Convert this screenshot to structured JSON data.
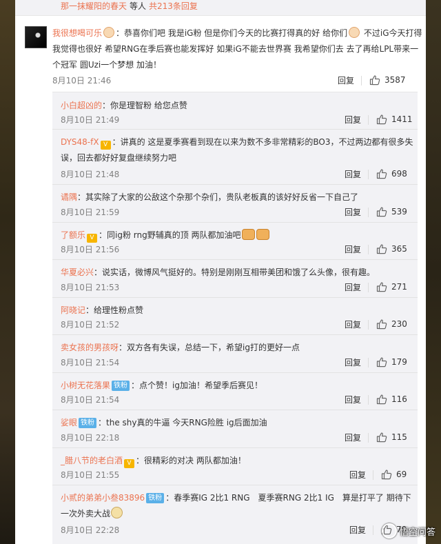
{
  "more_bar": {
    "user": "那一抹耀阳的春天",
    "mid": "等人",
    "count_text": "共213条回复"
  },
  "main_comment": {
    "user": "我很想喝可乐",
    "text_a": "：恭喜你们吧 我是iG粉 但是你们今天的比赛打得真的好 给你们",
    "text_b": " 不过iG今天打得我觉得也很好 希望RNG在季后赛也能发挥好 如果iG不能去世界赛 我希望你们去 去了再给LPL带来一个冠军 圆Uzi一个梦想 加油！",
    "date": "8月10日 21:46",
    "reply_label": "回复",
    "likes": "3587"
  },
  "replies": [
    {
      "user": "小白超凶的",
      "text": "：你是理智粉 给您点赞",
      "date": "8月10日 21:49",
      "reply_label": "回复",
      "likes": "1411"
    },
    {
      "user": "DYS48-fX",
      "text": "：讲真的 这是夏季赛看到现在以来为数不多非常精彩的BO3，不过两边都有很多失误，回去都好好复盘继续努力吧",
      "date": "8月10日 21:48",
      "reply_label": "回复",
      "likes": "698"
    },
    {
      "user": "谲隅",
      "text": "：其实除了大家的公敌这个杂那个杂们，贵队老板真的该好好反省一下自己了",
      "date": "8月10日 21:59",
      "reply_label": "回复",
      "likes": "539"
    },
    {
      "user": "了额乐",
      "text": "：同ig粉 rng野辅真的顶 两队都加油吧",
      "date": "8月10日 21:56",
      "reply_label": "回复",
      "likes": "365"
    },
    {
      "user": "华夏必兴",
      "text": "：说实话，微博风气挺好的。特别是刚刚互相带美团和饿了么头像，很有趣。",
      "date": "8月10日 21:53",
      "reply_label": "回复",
      "likes": "271"
    },
    {
      "user": "阿晓记",
      "text": "：给理性粉点赞",
      "date": "8月10日 21:52",
      "reply_label": "回复",
      "likes": "230"
    },
    {
      "user": "卖女孩的男孩呀",
      "text": "：双方各有失误，总结一下，希望ig打的更好一点",
      "date": "8月10日 21:54",
      "reply_label": "回复",
      "likes": "179"
    },
    {
      "user": "小树无花落果",
      "badge": "铁粉",
      "text": "：点个赞！ig加油！希望季后赛见！",
      "date": "8月10日 21:54",
      "reply_label": "回复",
      "likes": "116"
    },
    {
      "user": "娑眼",
      "badge": "铁粉",
      "text": "：the shy真的牛逼 今天RNG险胜 ig后面加油",
      "date": "8月10日 22:18",
      "reply_label": "回复",
      "likes": "115"
    },
    {
      "user": "_腊八节的老白酒",
      "text": "：很精彩的对决 两队都加油！",
      "date": "8月10日 21:55",
      "reply_label": "回复",
      "likes": "69"
    },
    {
      "user": "小贰的弟弟小叁83896",
      "badge": "铁粉",
      "text": "：春季赛IG 2比1 RNG　夏季赛RNG 2比1 IG　算是打平了 期待下一次外卖大战",
      "date": "8月10日 22:28",
      "reply_label": "回复",
      "likes": "70"
    }
  ],
  "watermark": "悟空问答",
  "colors": {
    "link": "#eb7350",
    "fan_badge": "#5ab0e8",
    "reply_bg": "#f2f2f5"
  }
}
